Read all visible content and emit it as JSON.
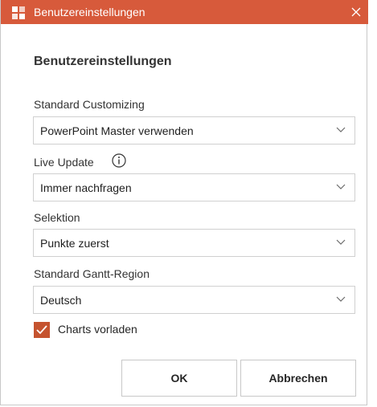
{
  "window": {
    "title": "Benutzereinstellungen",
    "icon": "app-logo-icon",
    "close_icon": "close-icon",
    "accent_color": "#d75a3b"
  },
  "dialog": {
    "heading": "Benutzereinstellungen",
    "fields": [
      {
        "label": "Standard Customizing",
        "value": "PowerPoint Master verwenden"
      },
      {
        "label": "Live Update",
        "value": "Immer nachfragen",
        "info_icon": "info-icon"
      },
      {
        "label": "Selektion",
        "value": "Punkte zuerst"
      },
      {
        "label": "Standard Gantt-Region",
        "value": "Deutsch"
      }
    ],
    "checkbox": {
      "label": "Charts vorladen",
      "checked": true,
      "color": "#c5532f"
    },
    "buttons": {
      "ok": "OK",
      "cancel": "Abbrechen"
    }
  }
}
